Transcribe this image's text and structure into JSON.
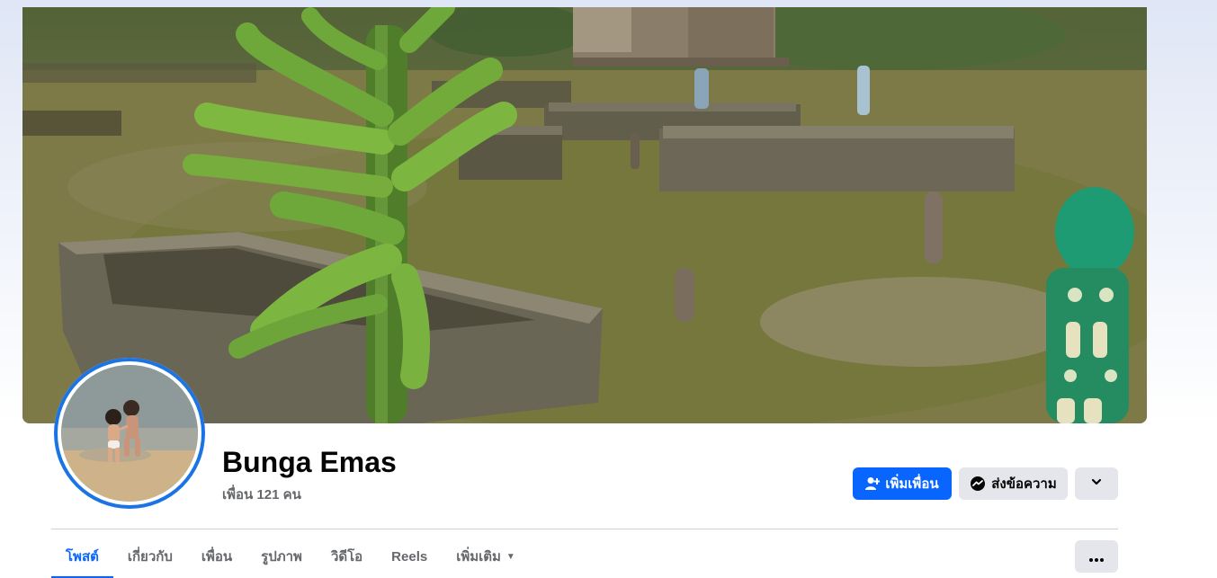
{
  "profile": {
    "name": "Bunga Emas",
    "friends_text": "เพื่อน 121 คน"
  },
  "actions": {
    "add_friend_label": "เพิ่มเพื่อน",
    "message_label": "ส่งข้อความ",
    "add_friend_icon": "add-friend-icon",
    "message_icon": "messenger-icon",
    "more_icon": "chevron-down-icon"
  },
  "tabs": [
    {
      "label": "โพสต์",
      "active": true
    },
    {
      "label": "เกี่ยวกับ",
      "active": false
    },
    {
      "label": "เพื่อน",
      "active": false
    },
    {
      "label": "รูปภาพ",
      "active": false
    },
    {
      "label": "วิดีโอ",
      "active": false
    },
    {
      "label": "Reels",
      "active": false
    },
    {
      "label": "เพิ่มเติม",
      "active": false
    }
  ],
  "tab_overflow_icon": "ellipsis-icon",
  "colors": {
    "accent": "#0866ff",
    "button_secondary": "#e4e6eb",
    "text_secondary": "#65676b",
    "avatar_ring": "#1b74e4"
  }
}
